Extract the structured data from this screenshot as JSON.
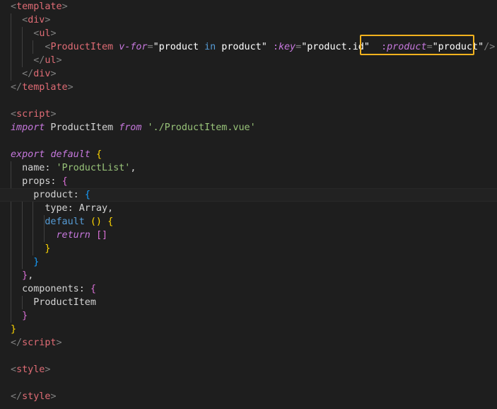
{
  "theme": {
    "background": "#1e1e1e",
    "tag_bracket": "#808080",
    "tag": "#569cd6",
    "component_tag": "#e06c75",
    "directive": "#c678dd",
    "attr_string": "#ffffff",
    "keyword": "#c678dd",
    "string": "#98c379",
    "property": "#d4d4d4",
    "brace_yellow": "#ffd700",
    "brace_magenta": "#da70d6",
    "brace_blue": "#179fff",
    "highlight": "#f2b21e"
  },
  "highlighted_segment": ":product=\"product\"/>",
  "lines": [
    {
      "tokens": [
        {
          "t": "<",
          "c": "tag_bracket"
        },
        {
          "t": "template",
          "c": "component_tag"
        },
        {
          "t": ">",
          "c": "tag_bracket"
        }
      ]
    },
    {
      "tokens": [
        {
          "t": "  "
        },
        {
          "t": "<",
          "c": "tag_bracket"
        },
        {
          "t": "div",
          "c": "component_tag"
        },
        {
          "t": ">",
          "c": "tag_bracket"
        }
      ]
    },
    {
      "tokens": [
        {
          "t": "    "
        },
        {
          "t": "<",
          "c": "tag_bracket"
        },
        {
          "t": "ul",
          "c": "component_tag"
        },
        {
          "t": ">",
          "c": "tag_bracket"
        }
      ]
    },
    {
      "tokens": [
        {
          "t": "      "
        },
        {
          "t": "<",
          "c": "tag_bracket"
        },
        {
          "t": "ProductItem",
          "c": "component_tag"
        },
        {
          "t": " "
        },
        {
          "t": "v-for",
          "c": "directive",
          "i": true
        },
        {
          "t": "=",
          "c": "tag_bracket"
        },
        {
          "t": "\"product ",
          "c": "attr_string"
        },
        {
          "t": "in",
          "c": "tag",
          "i": false
        },
        {
          "t": " product\"",
          "c": "attr_string"
        },
        {
          "t": " "
        },
        {
          "t": ":",
          "c": "directive"
        },
        {
          "t": "key",
          "c": "directive",
          "i": true
        },
        {
          "t": "=",
          "c": "tag_bracket"
        },
        {
          "t": "\"product.id\"",
          "c": "attr_string"
        },
        {
          "t": "  "
        },
        {
          "t": ":",
          "c": "directive"
        },
        {
          "t": "product",
          "c": "directive",
          "i": true
        },
        {
          "t": "=",
          "c": "tag_bracket"
        },
        {
          "t": "\"product\"",
          "c": "attr_string"
        },
        {
          "t": "/>",
          "c": "tag_bracket"
        }
      ]
    },
    {
      "tokens": [
        {
          "t": "    "
        },
        {
          "t": "</",
          "c": "tag_bracket"
        },
        {
          "t": "ul",
          "c": "component_tag"
        },
        {
          "t": ">",
          "c": "tag_bracket"
        }
      ]
    },
    {
      "tokens": [
        {
          "t": "  "
        },
        {
          "t": "</",
          "c": "tag_bracket"
        },
        {
          "t": "div",
          "c": "component_tag"
        },
        {
          "t": ">",
          "c": "tag_bracket"
        }
      ]
    },
    {
      "tokens": [
        {
          "t": "</",
          "c": "tag_bracket"
        },
        {
          "t": "template",
          "c": "component_tag"
        },
        {
          "t": ">",
          "c": "tag_bracket"
        }
      ]
    },
    {
      "tokens": []
    },
    {
      "tokens": [
        {
          "t": "<",
          "c": "tag_bracket"
        },
        {
          "t": "script",
          "c": "component_tag"
        },
        {
          "t": ">",
          "c": "tag_bracket"
        }
      ]
    },
    {
      "tokens": [
        {
          "t": "import",
          "c": "keyword",
          "i": true
        },
        {
          "t": " ProductItem ",
          "c": "property"
        },
        {
          "t": "from",
          "c": "keyword",
          "i": true
        },
        {
          "t": " "
        },
        {
          "t": "'./ProductItem.vue'",
          "c": "string"
        }
      ]
    },
    {
      "tokens": []
    },
    {
      "tokens": [
        {
          "t": "export",
          "c": "keyword",
          "i": true
        },
        {
          "t": " "
        },
        {
          "t": "default",
          "c": "keyword",
          "i": true
        },
        {
          "t": " "
        },
        {
          "t": "{",
          "c": "brace_yellow"
        }
      ]
    },
    {
      "tokens": [
        {
          "t": "  name: ",
          "c": "property"
        },
        {
          "t": "'ProductList'",
          "c": "string"
        },
        {
          "t": ",",
          "c": "property"
        }
      ]
    },
    {
      "tokens": [
        {
          "t": "  props: ",
          "c": "property"
        },
        {
          "t": "{",
          "c": "brace_magenta"
        }
      ]
    },
    {
      "current": true,
      "tokens": [
        {
          "t": "    product: ",
          "c": "property"
        },
        {
          "t": "{",
          "c": "brace_blue"
        }
      ]
    },
    {
      "tokens": [
        {
          "t": "      type: Array,",
          "c": "property"
        }
      ]
    },
    {
      "tokens": [
        {
          "t": "      "
        },
        {
          "t": "default",
          "c": "tag"
        },
        {
          "t": " "
        },
        {
          "t": "()",
          "c": "brace_yellow"
        },
        {
          "t": " "
        },
        {
          "t": "{",
          "c": "brace_yellow"
        }
      ]
    },
    {
      "tokens": [
        {
          "t": "        "
        },
        {
          "t": "return",
          "c": "keyword",
          "i": true
        },
        {
          "t": " "
        },
        {
          "t": "[]",
          "c": "brace_magenta"
        }
      ]
    },
    {
      "tokens": [
        {
          "t": "      "
        },
        {
          "t": "}",
          "c": "brace_yellow"
        }
      ]
    },
    {
      "tokens": [
        {
          "t": "    "
        },
        {
          "t": "}",
          "c": "brace_blue"
        }
      ]
    },
    {
      "tokens": [
        {
          "t": "  "
        },
        {
          "t": "}",
          "c": "brace_magenta"
        },
        {
          "t": ",",
          "c": "property"
        }
      ]
    },
    {
      "tokens": [
        {
          "t": "  components: ",
          "c": "property"
        },
        {
          "t": "{",
          "c": "brace_magenta"
        }
      ]
    },
    {
      "tokens": [
        {
          "t": "    ProductItem",
          "c": "property"
        }
      ]
    },
    {
      "tokens": [
        {
          "t": "  "
        },
        {
          "t": "}",
          "c": "brace_magenta"
        }
      ]
    },
    {
      "tokens": [
        {
          "t": "}",
          "c": "brace_yellow"
        }
      ]
    },
    {
      "tokens": [
        {
          "t": "</",
          "c": "tag_bracket"
        },
        {
          "t": "script",
          "c": "component_tag"
        },
        {
          "t": ">",
          "c": "tag_bracket"
        }
      ]
    },
    {
      "tokens": []
    },
    {
      "tokens": [
        {
          "t": "<",
          "c": "tag_bracket"
        },
        {
          "t": "style",
          "c": "component_tag"
        },
        {
          "t": ">",
          "c": "tag_bracket"
        }
      ]
    },
    {
      "tokens": []
    },
    {
      "tokens": [
        {
          "t": "</",
          "c": "tag_bracket"
        },
        {
          "t": "style",
          "c": "component_tag"
        },
        {
          "t": ">",
          "c": "tag_bracket"
        }
      ]
    }
  ]
}
